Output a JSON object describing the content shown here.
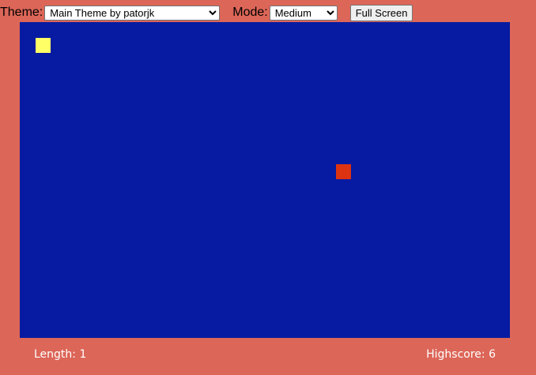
{
  "toolbar": {
    "theme_label": "Theme:",
    "theme_selected": "Main Theme by patorjk",
    "mode_label": "Mode:",
    "mode_selected": "Medium",
    "fullscreen_label": "Full Screen"
  },
  "game": {
    "board_color": "#061ba1",
    "background_color": "#dc6658",
    "snake_color": "#ffff66",
    "food_color": "#dd3311",
    "grid": {
      "cols": 31,
      "rows": 20
    },
    "snake": [
      {
        "col": 1,
        "row": 1
      }
    ],
    "food": {
      "col": 20,
      "row": 9
    }
  },
  "footer": {
    "length_text": "Length: 1",
    "highscore_text": "Highscore: 6"
  }
}
